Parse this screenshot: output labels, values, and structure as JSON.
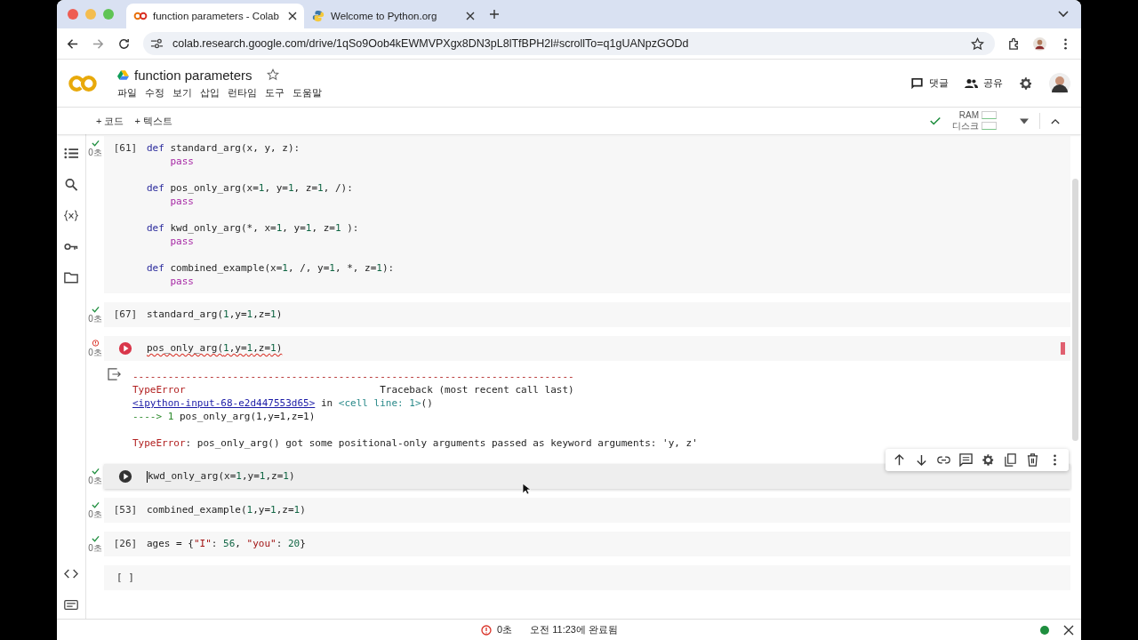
{
  "browser": {
    "tabs": [
      {
        "title": "function parameters - Colab",
        "selected": true
      },
      {
        "title": "Welcome to Python.org",
        "selected": false
      }
    ],
    "url": "colab.research.google.com/drive/1qSo9Oob4kEWMVPXgx8DN3pL8lTfBPH2l#scrollTo=q1gUANpzGODd"
  },
  "notebook": {
    "title": "function parameters",
    "menu": [
      "파일",
      "수정",
      "보기",
      "삽입",
      "런타임",
      "도구",
      "도움말"
    ],
    "header_actions": [
      "댓글",
      "공유"
    ],
    "add_buttons": [
      "+ 코드",
      "+ 텍스트"
    ],
    "resources": [
      "RAM",
      "디스크"
    ]
  },
  "cells": [
    {
      "kind": "ok",
      "time": "0초",
      "exec": "[61]",
      "lines": [
        {
          "kind": "code",
          "tokens": [
            {
              "t": "def",
              "kind": "kw"
            },
            {
              "t": " standard_arg(x, y, z):",
              "kind": "plain"
            }
          ]
        },
        {
          "kind": "code",
          "tokens": [
            {
              "t": "    pass",
              "kind": "ctl"
            }
          ]
        },
        {
          "kind": "blank"
        },
        {
          "kind": "code",
          "tokens": [
            {
              "t": "def",
              "kind": "kw"
            },
            {
              "t": " pos_only_arg(x=",
              "kind": "plain"
            },
            {
              "t": "1",
              "kind": "num"
            },
            {
              "t": ", y=",
              "kind": "plain"
            },
            {
              "t": "1",
              "kind": "num"
            },
            {
              "t": ", z=",
              "kind": "plain"
            },
            {
              "t": "1",
              "kind": "num"
            },
            {
              "t": ", /):",
              "kind": "plain"
            }
          ]
        },
        {
          "kind": "code",
          "tokens": [
            {
              "t": "    pass",
              "kind": "ctl"
            }
          ]
        },
        {
          "kind": "blank"
        },
        {
          "kind": "code",
          "tokens": [
            {
              "t": "def",
              "kind": "kw"
            },
            {
              "t": " kwd_only_arg(*, x=",
              "kind": "plain"
            },
            {
              "t": "1",
              "kind": "num"
            },
            {
              "t": ", y=",
              "kind": "plain"
            },
            {
              "t": "1",
              "kind": "num"
            },
            {
              "t": ", z=",
              "kind": "plain"
            },
            {
              "t": "1",
              "kind": "num"
            },
            {
              "t": " ):",
              "kind": "plain"
            }
          ]
        },
        {
          "kind": "code",
          "tokens": [
            {
              "t": "    pass",
              "kind": "ctl"
            }
          ]
        },
        {
          "kind": "blank"
        },
        {
          "kind": "code",
          "tokens": [
            {
              "t": "def",
              "kind": "kw"
            },
            {
              "t": " combined_example(x=",
              "kind": "plain"
            },
            {
              "t": "1",
              "kind": "num"
            },
            {
              "t": ", /, y=",
              "kind": "plain"
            },
            {
              "t": "1",
              "kind": "num"
            },
            {
              "t": ", *, z=",
              "kind": "plain"
            },
            {
              "t": "1",
              "kind": "num"
            },
            {
              "t": "):",
              "kind": "plain"
            }
          ]
        },
        {
          "kind": "code",
          "tokens": [
            {
              "t": "    pass",
              "kind": "ctl"
            }
          ]
        }
      ]
    },
    {
      "kind": "ok",
      "time": "0초",
      "exec": "[67]",
      "lines": [
        {
          "kind": "code",
          "tokens": [
            {
              "t": "standard_arg(",
              "kind": "plain"
            },
            {
              "t": "1",
              "kind": "num"
            },
            {
              "t": ",y=",
              "kind": "plain"
            },
            {
              "t": "1",
              "kind": "num"
            },
            {
              "t": ",z=",
              "kind": "plain"
            },
            {
              "t": "1",
              "kind": "num"
            },
            {
              "t": ")",
              "kind": "plain"
            }
          ]
        }
      ]
    },
    {
      "kind": "error",
      "time": "0초",
      "squiggle": true,
      "lines": [
        {
          "kind": "code",
          "tokens": [
            {
              "t": "pos_only_arg(",
              "kind": "plain"
            },
            {
              "t": "1",
              "kind": "num"
            },
            {
              "t": ",y=",
              "kind": "plain"
            },
            {
              "t": "1",
              "kind": "num"
            },
            {
              "t": ",z=",
              "kind": "plain"
            },
            {
              "t": "1",
              "kind": "num"
            },
            {
              "t": ")",
              "kind": "plain"
            }
          ]
        }
      ],
      "output": [
        {
          "kind": "code",
          "tokens": [
            {
              "t": "---------------------------------------------------------------------------",
              "kind": "err"
            }
          ]
        },
        {
          "kind": "code",
          "tokens": [
            {
              "t": "TypeError",
              "kind": "err"
            },
            {
              "t": "                                 Traceback (most recent call last)",
              "kind": "plain"
            }
          ]
        },
        {
          "kind": "code",
          "tokens": [
            {
              "t": "<ipython-input-68-e2d447553d65>",
              "kind": "link"
            },
            {
              "t": " in ",
              "kind": "plain"
            },
            {
              "t": "<cell line: 1>",
              "kind": "teal"
            },
            {
              "t": "()",
              "kind": "plain"
            }
          ]
        },
        {
          "kind": "code",
          "tokens": [
            {
              "t": "----> 1 ",
              "kind": "arrow"
            },
            {
              "t": "pos_only_arg(1,y=1,z=1)",
              "kind": "plain"
            }
          ]
        },
        {
          "kind": "blank"
        },
        {
          "kind": "code",
          "tokens": [
            {
              "t": "TypeError",
              "kind": "err"
            },
            {
              "t": ": pos_only_arg() got some positional-only arguments passed as keyword arguments: 'y, z'",
              "kind": "plain"
            }
          ]
        }
      ]
    },
    {
      "kind": "ok",
      "time": "0초",
      "focused": true,
      "lines": [
        {
          "kind": "code",
          "tokens": [
            {
              "t": "kwd_only_arg(x=",
              "kind": "plain"
            },
            {
              "t": "1",
              "kind": "num"
            },
            {
              "t": ",y=",
              "kind": "plain"
            },
            {
              "t": "1",
              "kind": "num"
            },
            {
              "t": ",z=",
              "kind": "plain"
            },
            {
              "t": "1",
              "kind": "num"
            },
            {
              "t": ")",
              "kind": "plain"
            }
          ]
        }
      ]
    },
    {
      "kind": "ok",
      "time": "0초",
      "exec": "[53]",
      "lines": [
        {
          "kind": "code",
          "tokens": [
            {
              "t": "combined_example(",
              "kind": "plain"
            },
            {
              "t": "1",
              "kind": "num"
            },
            {
              "t": ",y=",
              "kind": "plain"
            },
            {
              "t": "1",
              "kind": "num"
            },
            {
              "t": ",z=",
              "kind": "plain"
            },
            {
              "t": "1",
              "kind": "num"
            },
            {
              "t": ")",
              "kind": "plain"
            }
          ]
        }
      ]
    },
    {
      "kind": "ok",
      "time": "0초",
      "exec": "[26]",
      "lines": [
        {
          "kind": "code",
          "tokens": [
            {
              "t": "ages = {",
              "kind": "plain"
            },
            {
              "t": "\"I\"",
              "kind": "str"
            },
            {
              "t": ": ",
              "kind": "plain"
            },
            {
              "t": "56",
              "kind": "num"
            },
            {
              "t": ", ",
              "kind": "plain"
            },
            {
              "t": "\"you\"",
              "kind": "str"
            },
            {
              "t": ": ",
              "kind": "plain"
            },
            {
              "t": "20",
              "kind": "num"
            },
            {
              "t": "}",
              "kind": "plain"
            }
          ]
        }
      ]
    },
    {
      "kind": "empty",
      "exec": "[ ]"
    }
  ],
  "status_bar": {
    "duration": "0초",
    "message": "오전 11:23에 완료됨",
    "connected": true
  }
}
